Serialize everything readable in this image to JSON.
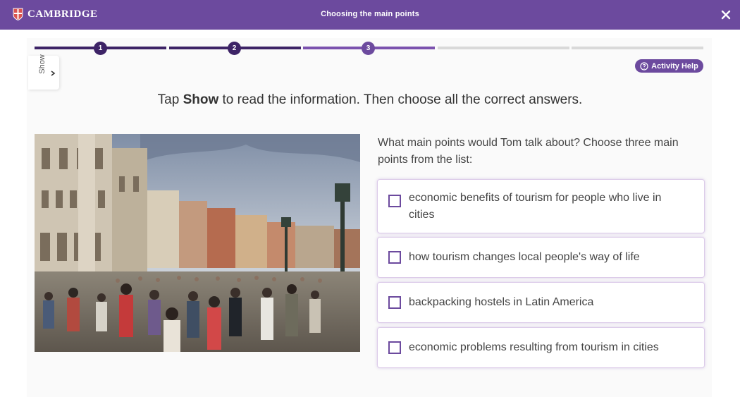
{
  "header": {
    "brand": "CAMBRIDGE",
    "title": "Choosing the main points",
    "close_icon": "close-icon",
    "color": "#6c4a9e"
  },
  "progress": {
    "steps": [
      "1",
      "2",
      "3"
    ],
    "current_step": 3,
    "total_segments": 5,
    "completed_color": "#3d2366",
    "active_color": "#7b52ae",
    "pending_color": "#d9d9d9"
  },
  "sidebar": {
    "show_label": "Show"
  },
  "help": {
    "label": "Activity Help",
    "icon": "question-circle-icon"
  },
  "instruction": {
    "part1": "Tap ",
    "bold": "Show",
    "part2": " to read the information. Then choose all the correct answers."
  },
  "question": {
    "text": "What main points would Tom talk about? Choose three main points from the list:"
  },
  "options": [
    {
      "label": "economic benefits of tourism for people who live in cities",
      "checked": false
    },
    {
      "label": "how tourism changes local people's way of life",
      "checked": false
    },
    {
      "label": "backpacking hostels in Latin America",
      "checked": false
    },
    {
      "label": "economic problems resulting from tourism in cities",
      "checked": false
    }
  ]
}
